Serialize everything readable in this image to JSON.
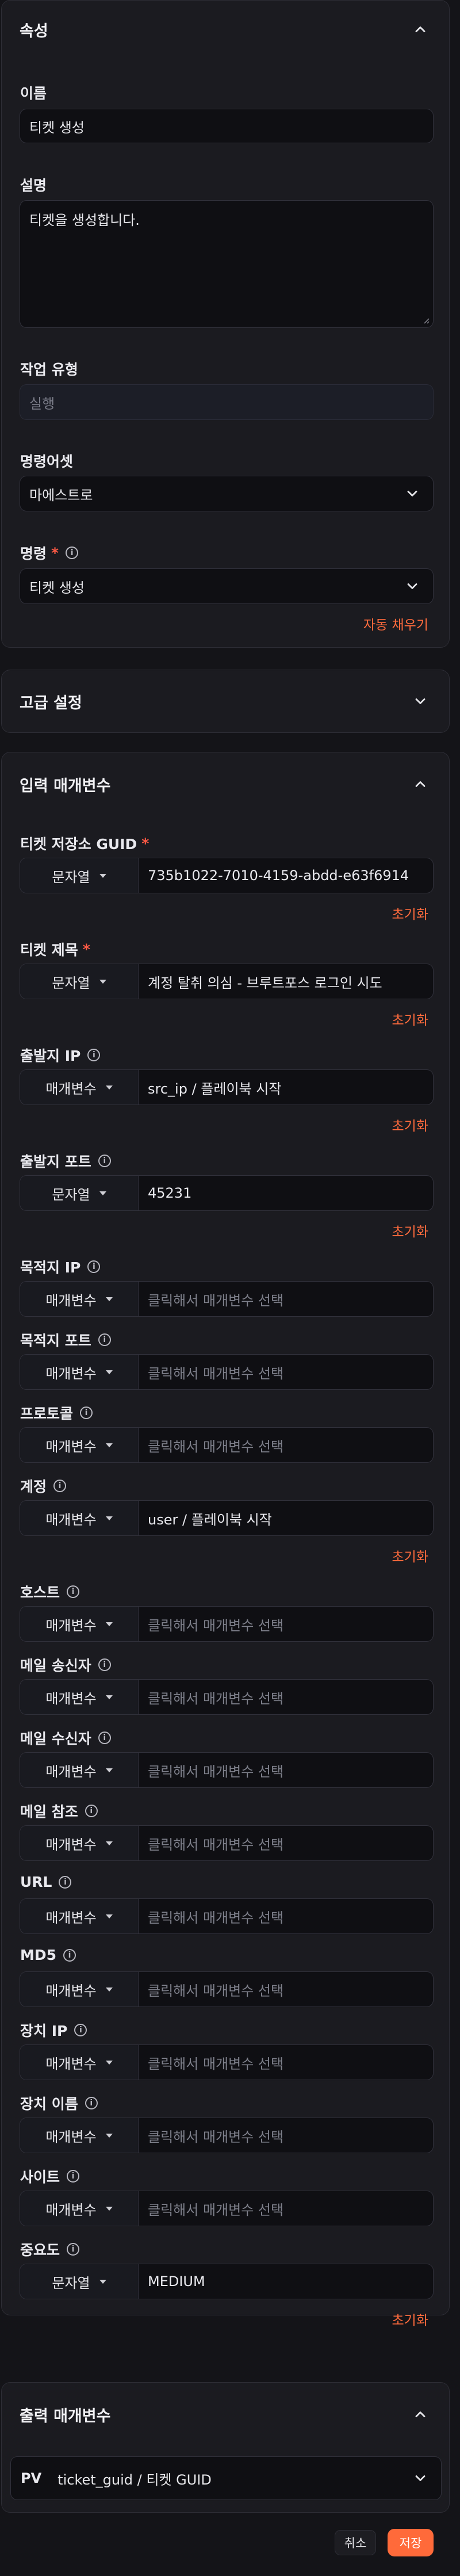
{
  "properties": {
    "title": "속성",
    "name_label": "이름",
    "name_value": "티켓 생성",
    "desc_label": "설명",
    "desc_value": "티켓을 생성합니다.",
    "task_type_label": "작업 유형",
    "task_type_value": "실행",
    "asset_label": "명령어셋",
    "asset_value": "마에스트로",
    "command_label": "명령",
    "command_value": "티켓 생성",
    "autofill": "자동 채우기"
  },
  "advanced": {
    "title": "고급 설정"
  },
  "inputs": {
    "title": "입력 매개변수",
    "reset_label": "초기화",
    "params": [
      {
        "label": "티켓 저장소 GUID",
        "required": true,
        "type": "문자열",
        "value": "735b1022-7010-4159-abdd-e63f6914",
        "placeholder": false,
        "reset": true
      },
      {
        "label": "티켓 제목",
        "required": true,
        "type": "문자열",
        "value": "계정 탈취 의심 - 브루트포스 로그인 시도",
        "placeholder": false,
        "reset": true
      },
      {
        "label": "출발지 IP",
        "info": true,
        "type": "매개변수",
        "value": "src_ip / 플레이북 시작",
        "placeholder": false,
        "reset": true
      },
      {
        "label": "출발지 포트",
        "info": true,
        "type": "문자열",
        "value": "45231",
        "placeholder": false,
        "reset": true
      },
      {
        "label": "목적지 IP",
        "info": true,
        "type": "매개변수",
        "value": "클릭해서 매개변수 선택",
        "placeholder": true
      },
      {
        "label": "목적지 포트",
        "info": true,
        "type": "매개변수",
        "value": "클릭해서 매개변수 선택",
        "placeholder": true
      },
      {
        "label": "프로토콜",
        "info": true,
        "type": "매개변수",
        "value": "클릭해서 매개변수 선택",
        "placeholder": true
      },
      {
        "label": "계정",
        "info": true,
        "type": "매개변수",
        "value": "user / 플레이북 시작",
        "placeholder": false,
        "reset": true
      },
      {
        "label": "호스트",
        "info": true,
        "type": "매개변수",
        "value": "클릭해서 매개변수 선택",
        "placeholder": true
      },
      {
        "label": "메일 송신자",
        "info": true,
        "type": "매개변수",
        "value": "클릭해서 매개변수 선택",
        "placeholder": true
      },
      {
        "label": "메일 수신자",
        "info": true,
        "type": "매개변수",
        "value": "클릭해서 매개변수 선택",
        "placeholder": true
      },
      {
        "label": "메일 참조",
        "info": true,
        "type": "매개변수",
        "value": "클릭해서 매개변수 선택",
        "placeholder": true
      },
      {
        "label": "URL",
        "info": true,
        "type": "매개변수",
        "value": "클릭해서 매개변수 선택",
        "placeholder": true
      },
      {
        "label": "MD5",
        "info": true,
        "type": "매개변수",
        "value": "클릭해서 매개변수 선택",
        "placeholder": true
      },
      {
        "label": "장치 IP",
        "info": true,
        "type": "매개변수",
        "value": "클릭해서 매개변수 선택",
        "placeholder": true
      },
      {
        "label": "장치 이름",
        "info": true,
        "type": "매개변수",
        "value": "클릭해서 매개변수 선택",
        "placeholder": true
      },
      {
        "label": "사이트",
        "info": true,
        "type": "매개변수",
        "value": "클릭해서 매개변수 선택",
        "placeholder": true
      },
      {
        "label": "중요도",
        "info": true,
        "type": "문자열",
        "value": "MEDIUM",
        "placeholder": false,
        "reset": true
      }
    ]
  },
  "outputs": {
    "title": "출력 매개변수",
    "badge": "PV",
    "value": "ticket_guid / 티켓 GUID"
  },
  "footer": {
    "cancel": "취소",
    "save": "저장"
  }
}
